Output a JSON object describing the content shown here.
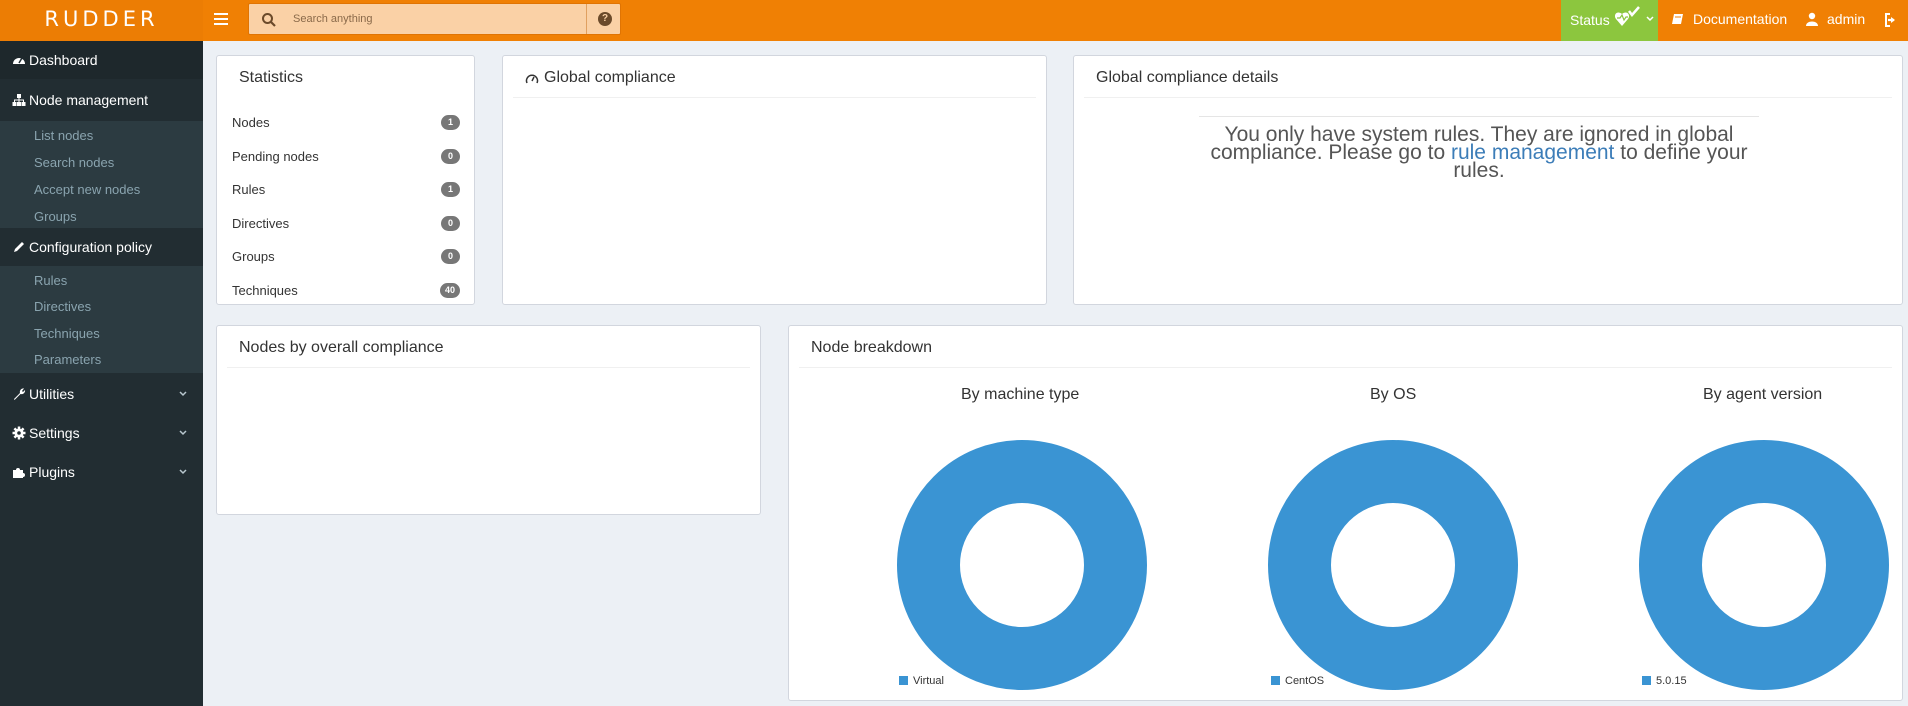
{
  "header": {
    "logo": "RUDDER",
    "search_placeholder": "Search anything",
    "help_glyph": "?",
    "status_label": "Status",
    "documentation_label": "Documentation",
    "user_label": "admin",
    "colors": {
      "topbar": "#f08004",
      "status": "#8cc63e"
    }
  },
  "sidebar": {
    "items": [
      {
        "label": "Dashboard",
        "icon": "dashboard-icon"
      },
      {
        "label": "Node management",
        "icon": "sitemap-icon"
      },
      {
        "label": "Configuration policy",
        "icon": "pencil-icon"
      },
      {
        "label": "Utilities",
        "icon": "wrench-icon"
      },
      {
        "label": "Settings",
        "icon": "gear-icon"
      },
      {
        "label": "Plugins",
        "icon": "puzzle-icon"
      }
    ],
    "node_management_sub": [
      "List nodes",
      "Search nodes",
      "Accept new nodes",
      "Groups"
    ],
    "configuration_policy_sub": [
      "Rules",
      "Directives",
      "Techniques",
      "Parameters"
    ]
  },
  "statistics": {
    "title": "Statistics",
    "rows": [
      {
        "label": "Nodes",
        "count": "1"
      },
      {
        "label": "Pending nodes",
        "count": "0"
      },
      {
        "label": "Rules",
        "count": "1"
      },
      {
        "label": "Directives",
        "count": "0"
      },
      {
        "label": "Groups",
        "count": "0"
      },
      {
        "label": "Techniques",
        "count": "40"
      }
    ]
  },
  "global_compliance": {
    "title": "Global compliance",
    "icon": "gauge-icon"
  },
  "global_compliance_details": {
    "title": "Global compliance details",
    "message_before": "You only have system rules. They are ignored in global compliance. Please go to ",
    "link_text": "rule management",
    "message_after": " to define your rules."
  },
  "nodes_by_compliance": {
    "title": "Nodes by overall compliance"
  },
  "node_breakdown": {
    "title": "Node breakdown",
    "charts": [
      {
        "title": "By machine type",
        "legend": "Virtual"
      },
      {
        "title": "By OS",
        "legend": "CentOS"
      },
      {
        "title": "By agent version",
        "legend": "5.0.15"
      }
    ]
  },
  "chart_data": [
    {
      "type": "pie",
      "title": "By machine type",
      "categories": [
        "Virtual"
      ],
      "values": [
        1
      ],
      "colors": [
        "#3a94d3"
      ]
    },
    {
      "type": "pie",
      "title": "By OS",
      "categories": [
        "CentOS"
      ],
      "values": [
        1
      ],
      "colors": [
        "#3a94d3"
      ]
    },
    {
      "type": "pie",
      "title": "By agent version",
      "categories": [
        "5.0.15"
      ],
      "values": [
        1
      ],
      "colors": [
        "#3a94d3"
      ]
    }
  ]
}
